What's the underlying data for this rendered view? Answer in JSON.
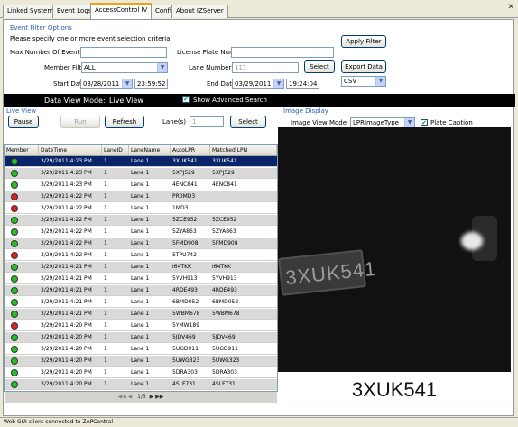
{
  "tabs": [
    "Linked Systems",
    "Event Logs",
    "AccessControl IV",
    "Config",
    "About IZServer"
  ],
  "filter": {
    "legend": "Event Filter Options",
    "instruction": "Please specify one or more event selection criteria:",
    "max_events_label": "Max Number Of Events",
    "max_events_value": "",
    "plate_label": "License Plate Number",
    "plate_value": "",
    "member_label": "Member Filter",
    "member_value": "ALL",
    "lane_label": "Lane Number(s)",
    "lane_value": "111",
    "select_label": "Select",
    "start_label": "Start Date",
    "start_date": "03/28/2011",
    "start_time": "23:59:52",
    "end_label": "End Date",
    "end_date": "03/29/2011",
    "end_time": "19:24:04",
    "apply_label": "Apply Filter",
    "export_label": "Export Data",
    "format_value": "CSV"
  },
  "mode": {
    "label": "Data View Mode:",
    "value": "Live View",
    "advanced_label": "Show Advanced Search"
  },
  "live": {
    "legend": "Live View",
    "pause_label": "Pause",
    "run_label": "Run",
    "refresh_label": "Refresh",
    "lanes_label": "Lane(s)",
    "lanes_value": "1",
    "select_label": "Select"
  },
  "table": {
    "columns": [
      "Member",
      "DateTime",
      "LaneID",
      "LaneName",
      "AutoLPR",
      "Matched LPN"
    ],
    "rows": [
      {
        "status": "green",
        "datetime": "3/29/2011 4:23 PM",
        "laneid": "1",
        "lanename": "Lane 1",
        "autolpr": "3XUK541",
        "matched": "3XUK541"
      },
      {
        "status": "green",
        "datetime": "3/29/2011 4:23 PM",
        "laneid": "1",
        "lanename": "Lane 1",
        "autolpr": "5XPJ529",
        "matched": "5XPJ529"
      },
      {
        "status": "green",
        "datetime": "3/29/2011 4:23 PM",
        "laneid": "1",
        "lanename": "Lane 1",
        "autolpr": "4ENC841",
        "matched": "4ENC841"
      },
      {
        "status": "red",
        "datetime": "3/29/2011 4:22 PM",
        "laneid": "1",
        "lanename": "Lane 1",
        "autolpr": "PR0MD3",
        "matched": ""
      },
      {
        "status": "red",
        "datetime": "3/29/2011 4:22 PM",
        "laneid": "1",
        "lanename": "Lane 1",
        "autolpr": "1MD3",
        "matched": ""
      },
      {
        "status": "green",
        "datetime": "3/29/2011 4:22 PM",
        "laneid": "1",
        "lanename": "Lane 1",
        "autolpr": "5ZCE952",
        "matched": "5ZCE952"
      },
      {
        "status": "green",
        "datetime": "3/29/2011 4:22 PM",
        "laneid": "1",
        "lanename": "Lane 1",
        "autolpr": "5ZYA863",
        "matched": "5ZYA863"
      },
      {
        "status": "green",
        "datetime": "3/29/2011 4:22 PM",
        "laneid": "1",
        "lanename": "Lane 1",
        "autolpr": "5FMD908",
        "matched": "5FMD908"
      },
      {
        "status": "red",
        "datetime": "3/29/2011 4:22 PM",
        "laneid": "1",
        "lanename": "Lane 1",
        "autolpr": "5TPU742",
        "matched": ""
      },
      {
        "status": "green",
        "datetime": "3/29/2011 4:21 PM",
        "laneid": "1",
        "lanename": "Lane 1",
        "autolpr": "I64TKK",
        "matched": "I64TKK"
      },
      {
        "status": "green",
        "datetime": "3/29/2011 4:21 PM",
        "laneid": "1",
        "lanename": "Lane 1",
        "autolpr": "5YVH913",
        "matched": "5YVH913"
      },
      {
        "status": "green",
        "datetime": "3/29/2011 4:21 PM",
        "laneid": "1",
        "lanename": "Lane 1",
        "autolpr": "4RDE493",
        "matched": "4RDE493"
      },
      {
        "status": "green",
        "datetime": "3/29/2011 4:21 PM",
        "laneid": "1",
        "lanename": "Lane 1",
        "autolpr": "6BMD052",
        "matched": "6BMD052"
      },
      {
        "status": "green",
        "datetime": "3/29/2011 4:21 PM",
        "laneid": "1",
        "lanename": "Lane 1",
        "autolpr": "5WBM678",
        "matched": "5WBM678"
      },
      {
        "status": "red",
        "datetime": "3/29/2011 4:20 PM",
        "laneid": "1",
        "lanename": "Lane 1",
        "autolpr": "5YMW189",
        "matched": ""
      },
      {
        "status": "green",
        "datetime": "3/29/2011 4:20 PM",
        "laneid": "1",
        "lanename": "Lane 1",
        "autolpr": "5JDV469",
        "matched": "5JDV469"
      },
      {
        "status": "green",
        "datetime": "3/29/2011 4:20 PM",
        "laneid": "1",
        "lanename": "Lane 1",
        "autolpr": "5UGD911",
        "matched": "5UGD911"
      },
      {
        "status": "green",
        "datetime": "3/29/2011 4:20 PM",
        "laneid": "1",
        "lanename": "Lane 1",
        "autolpr": "5UWG323",
        "matched": "5UWG323"
      },
      {
        "status": "green",
        "datetime": "3/29/2011 4:20 PM",
        "laneid": "1",
        "lanename": "Lane 1",
        "autolpr": "5DRA303",
        "matched": "5DRA303"
      },
      {
        "status": "green",
        "datetime": "3/29/2011 4:20 PM",
        "laneid": "1",
        "lanename": "Lane 1",
        "autolpr": "4SLF731",
        "matched": "4SLF731"
      }
    ],
    "pager": "1/5"
  },
  "image": {
    "legend": "Image Display",
    "mode_label": "Image View Mode",
    "mode_value": "LPRImageType",
    "caption_label": "Plate Caption",
    "plate_text": "3XUK541",
    "caption": "3XUK541"
  },
  "status": "Web GUI client connected to ZAPCentral",
  "colors": {
    "green": "#22c322",
    "red": "#e02020",
    "selected": "#0a246a",
    "accent": "#2b5bb3"
  }
}
